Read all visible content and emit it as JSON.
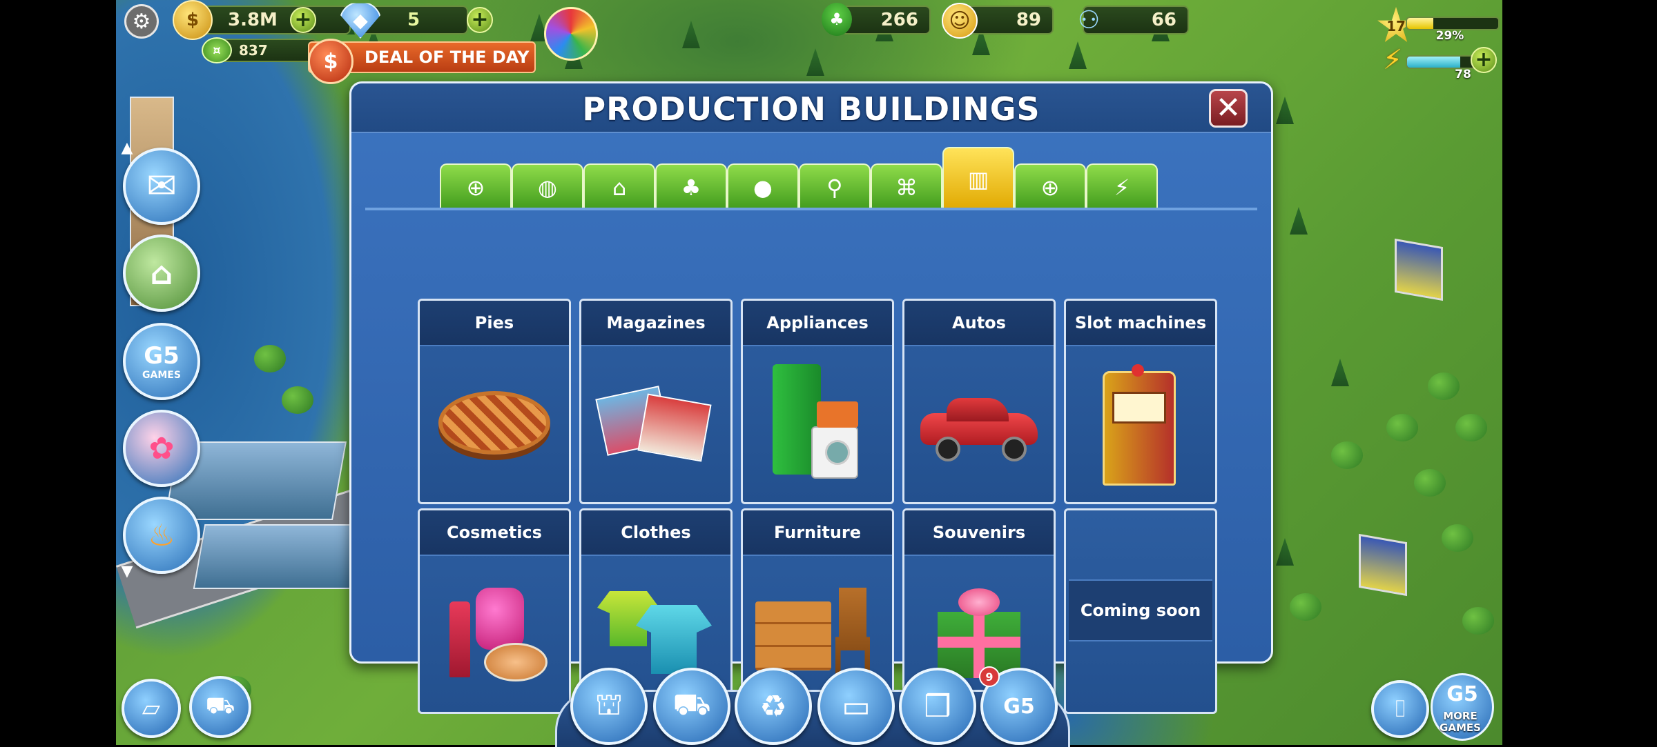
{
  "hud": {
    "coins": "3.8M",
    "gems": "5",
    "cash": "837",
    "deal": "DEAL OF THE DAY",
    "eco": "266",
    "happiness": "89",
    "population": "66",
    "level": "17",
    "xp_percent": "29%",
    "xp_fraction": 0.29,
    "energy": "78",
    "energy_fraction": 0.7
  },
  "sidebar": {
    "mail_icon": "mail-icon",
    "g5_label": "G5",
    "g5_sub": "GAMES"
  },
  "dialog": {
    "title": "PRODUCTION BUILDINGS",
    "tabs": [
      {
        "name": "tab-expansion",
        "icon": "⊕"
      },
      {
        "name": "tab-decor",
        "icon": "◍"
      },
      {
        "name": "tab-residential",
        "icon": "⌂"
      },
      {
        "name": "tab-parks",
        "icon": "♣"
      },
      {
        "name": "tab-leisure",
        "icon": "●"
      },
      {
        "name": "tab-landmarks",
        "icon": "⚲"
      },
      {
        "name": "tab-public",
        "icon": "⌘"
      },
      {
        "name": "tab-production",
        "icon": "▥",
        "active": true
      },
      {
        "name": "tab-security",
        "icon": "⊕"
      },
      {
        "name": "tab-energy",
        "icon": "⚡"
      }
    ],
    "items": [
      {
        "label": "Pies",
        "art": "pie"
      },
      {
        "label": "Magazines",
        "art": "magazines"
      },
      {
        "label": "Appliances",
        "art": "appliances"
      },
      {
        "label": "Autos",
        "art": "car"
      },
      {
        "label": "Slot machines",
        "art": "slot"
      },
      {
        "label": "Cosmetics",
        "art": "cosmetics"
      },
      {
        "label": "Clothes",
        "art": "clothes"
      },
      {
        "label": "Furniture",
        "art": "furniture"
      },
      {
        "label": "Souvenirs",
        "art": "gift"
      }
    ],
    "coming_soon": "Coming soon"
  },
  "bottom": {
    "badge": "9",
    "more_games": "MORE GAMES",
    "g5": "G5"
  },
  "colors": {
    "accent": "#3c74c0",
    "active_tab": "#ffd230",
    "tab_green": "#5cb82c"
  }
}
